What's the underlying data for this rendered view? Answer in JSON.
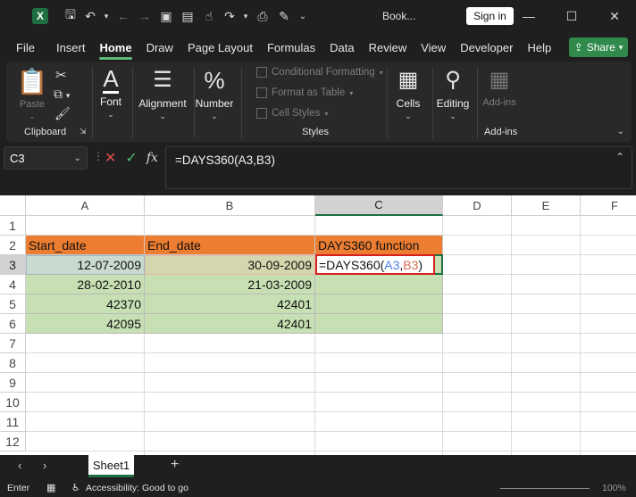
{
  "titlebar": {
    "workbook": "Book...",
    "sign_in": "Sign in"
  },
  "menu": {
    "items": [
      "File",
      "Insert",
      "Home",
      "Draw",
      "Page Layout",
      "Formulas",
      "Data",
      "Review",
      "View",
      "Developer",
      "Help"
    ],
    "active": "Home",
    "share": "Share"
  },
  "ribbon": {
    "paste": "Paste",
    "clipboard": "Clipboard",
    "font": "Font",
    "alignment": "Alignment",
    "number": "Number",
    "conditional_formatting": "Conditional Formatting",
    "format_as_table": "Format as Table",
    "cell_styles": "Cell Styles",
    "styles": "Styles",
    "cells": "Cells",
    "editing": "Editing",
    "addins_button": "Add-ins",
    "addins_group": "Add-ins"
  },
  "formula_bar": {
    "name_box": "C3",
    "fx": "fx",
    "formula": "=DAYS360(A3,B3)"
  },
  "sheet": {
    "columns": [
      "A",
      "B",
      "C",
      "D",
      "E",
      "F"
    ],
    "selected_column": "C",
    "rows": [
      "1",
      "2",
      "3",
      "4",
      "5",
      "6",
      "7",
      "8",
      "9",
      "10",
      "11",
      "12"
    ],
    "selected_row": "3",
    "headers": {
      "a2": "Start_date",
      "b2": "End_date",
      "c2": "DAYS360 function"
    },
    "data": [
      {
        "a": "12-07-2009",
        "b": "30-09-2009"
      },
      {
        "a": "28-02-2010",
        "b": "21-03-2009"
      },
      {
        "a": "42370",
        "b": "42401"
      },
      {
        "a": "42095",
        "b": "42401"
      }
    ],
    "edit_cell": {
      "prefix": "=DAYS360(",
      "ref1": "A3",
      "comma": ",",
      "ref2": "B3",
      "suffix": ")"
    }
  },
  "tabs": {
    "sheet_name": "Sheet1"
  },
  "status": {
    "mode": "Enter",
    "accessibility": "Accessibility: Good to go",
    "zoom": "100%"
  }
}
